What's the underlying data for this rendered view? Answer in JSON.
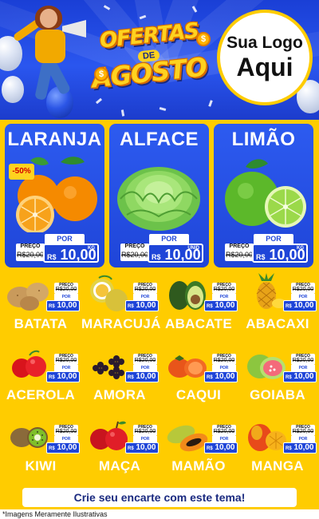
{
  "header": {
    "promo_line1": "OFERTAS",
    "promo_de": "DE",
    "promo_line2": "AGOSTO",
    "logo_line1": "Sua Logo",
    "logo_line2": "Aqui"
  },
  "colors": {
    "header_blue": "#2a56ef",
    "body_yellow": "#ffcc00",
    "card_blue": "#1f45d8",
    "promo_yellow": "#ffd21f",
    "discount_red": "#d00000"
  },
  "featured": [
    {
      "name": "LARANJA",
      "discount": "-50%",
      "preco_label": "PREÇO",
      "old_price": "R$20,00",
      "por_label": "POR",
      "currency": "R$",
      "new_price": "10,00",
      "unit": "KG",
      "icon": "orange-icon"
    },
    {
      "name": "ALFACE",
      "preco_label": "PREÇO",
      "old_price": "R$20,00",
      "por_label": "POR",
      "currency": "R$",
      "new_price": "10,00",
      "unit": "UNID",
      "icon": "lettuce-icon"
    },
    {
      "name": "LIMÃO",
      "preco_label": "PREÇO",
      "old_price": "R$20,00",
      "por_label": "POR",
      "currency": "R$",
      "new_price": "10,00",
      "unit": "KG",
      "icon": "lime-icon"
    }
  ],
  "products": [
    {
      "name": "BATATA",
      "preco_label": "PREÇO",
      "old_price": "R$20,00",
      "por_label": "POR",
      "currency": "R$",
      "new_price": "10,00",
      "icon": "potato-icon"
    },
    {
      "name": "MARACUJÁ",
      "preco_label": "PREÇO",
      "old_price": "R$20,00",
      "por_label": "POR",
      "currency": "R$",
      "new_price": "10,00",
      "icon": "passion-fruit-icon"
    },
    {
      "name": "ABACATE",
      "preco_label": "PREÇO",
      "old_price": "R$20,00",
      "por_label": "POR",
      "currency": "R$",
      "new_price": "10,00",
      "icon": "avocado-icon"
    },
    {
      "name": "ABACAXI",
      "preco_label": "PREÇO",
      "old_price": "R$20,00",
      "por_label": "POR",
      "currency": "R$",
      "new_price": "10,00",
      "icon": "pineapple-icon"
    },
    {
      "name": "ACEROLA",
      "preco_label": "PREÇO",
      "old_price": "R$20,00",
      "por_label": "POR",
      "currency": "R$",
      "new_price": "10,00",
      "icon": "acerola-icon"
    },
    {
      "name": "AMORA",
      "preco_label": "PREÇO",
      "old_price": "R$20,00",
      "por_label": "POR",
      "currency": "R$",
      "new_price": "10,00",
      "icon": "blackberry-icon"
    },
    {
      "name": "CAQUI",
      "preco_label": "PREÇO",
      "old_price": "R$20,00",
      "por_label": "POR",
      "currency": "R$",
      "new_price": "10,00",
      "icon": "persimmon-icon"
    },
    {
      "name": "GOIABA",
      "preco_label": "PREÇO",
      "old_price": "R$20,00",
      "por_label": "POR",
      "currency": "R$",
      "new_price": "10,00",
      "icon": "guava-icon"
    },
    {
      "name": "KIWI",
      "preco_label": "PREÇO",
      "old_price": "R$20,00",
      "por_label": "POR",
      "currency": "R$",
      "new_price": "10,00",
      "icon": "kiwi-icon"
    },
    {
      "name": "MAÇA",
      "preco_label": "PREÇO",
      "old_price": "R$20,00",
      "por_label": "POR",
      "currency": "R$",
      "new_price": "10,00",
      "icon": "apple-icon"
    },
    {
      "name": "MAMÃO",
      "preco_label": "PREÇO",
      "old_price": "R$20,00",
      "por_label": "POR",
      "currency": "R$",
      "new_price": "10,00",
      "icon": "papaya-icon"
    },
    {
      "name": "MANGA",
      "preco_label": "PREÇO",
      "old_price": "R$20,00",
      "por_label": "POR",
      "currency": "R$",
      "new_price": "10,00",
      "icon": "mango-icon"
    }
  ],
  "footer": {
    "cta": "Crie seu encarte com este tema!",
    "disclaimer": "*Imagens Meramente Ilustrativas"
  }
}
